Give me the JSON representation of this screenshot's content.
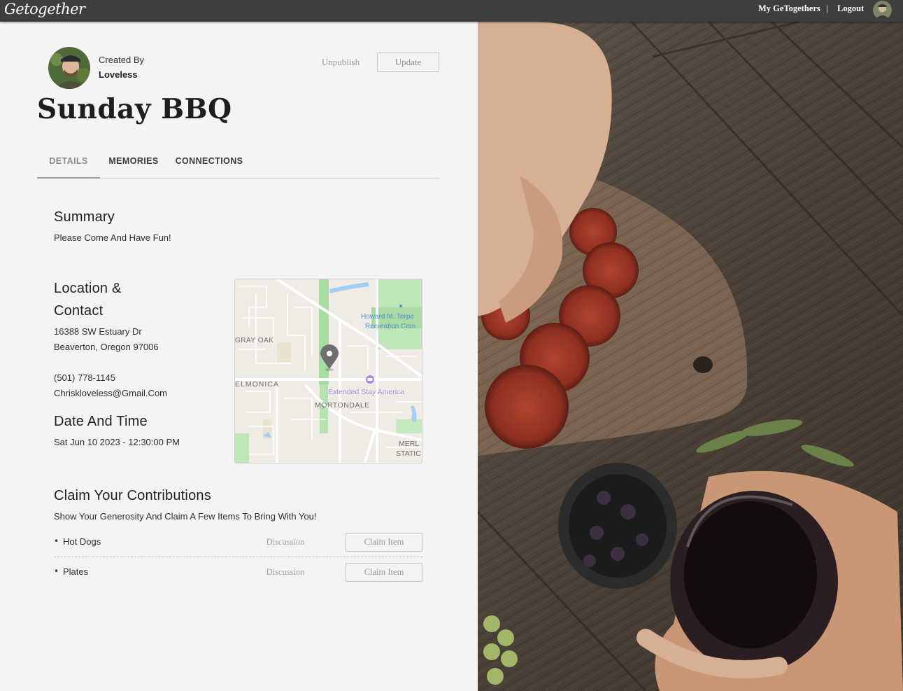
{
  "header": {
    "logo": "Getogether",
    "my_getogethers": "My GeTogethers",
    "separator": "|",
    "logout": "Logout"
  },
  "event": {
    "created_by_label": "Created By",
    "creator_name": "Loveless",
    "title": "Sunday BBQ",
    "unpublish_label": "Unpublish",
    "update_label": "Update"
  },
  "tabs": [
    {
      "label": "DETAILS",
      "active": true
    },
    {
      "label": "MEMORIES",
      "active": false
    },
    {
      "label": "CONNECTIONS",
      "active": false
    }
  ],
  "summary": {
    "heading": "Summary",
    "text": "Please Come And Have Fun!"
  },
  "location": {
    "heading_line1": "Location &",
    "heading_line2": "Contact",
    "address_line1": "16388 SW Estuary Dr",
    "address_line2": "Beaverton, Oregon 97006",
    "phone": "(501) 778-1145",
    "email": "Chriskloveless@Gmail.Com"
  },
  "datetime": {
    "heading": "Date And Time",
    "value": "Sat Jun 10 2023 - 12:30:00 PM"
  },
  "map": {
    "labels": {
      "park_line1": "Howard M. Terpe",
      "park_line2": "Recreation Com",
      "gray_oak": "GRAY OAK",
      "elmonica": "ELMONICA",
      "hotel": "Extended Stay America",
      "mortondale": "MORTONDALE",
      "merlo_line1": "MERL",
      "merlo_line2": "STATIC"
    }
  },
  "contributions": {
    "heading": "Claim Your Contributions",
    "subtext": "Show Your Generosity And Claim A Few Items To Bring With You!",
    "discussion_label": "Discussion",
    "claim_label": "Claim Item",
    "items": [
      {
        "name": "Hot Dogs"
      },
      {
        "name": "Plates"
      }
    ]
  },
  "colors": {
    "topbar": "#3e3e3e",
    "panel": "#f4f4f4",
    "text": "#2a2a2a",
    "muted_button": "#959595"
  },
  "icons": [
    "user-avatar-icon",
    "map-pin-icon",
    "hotel-icon",
    "bullet-icon"
  ]
}
